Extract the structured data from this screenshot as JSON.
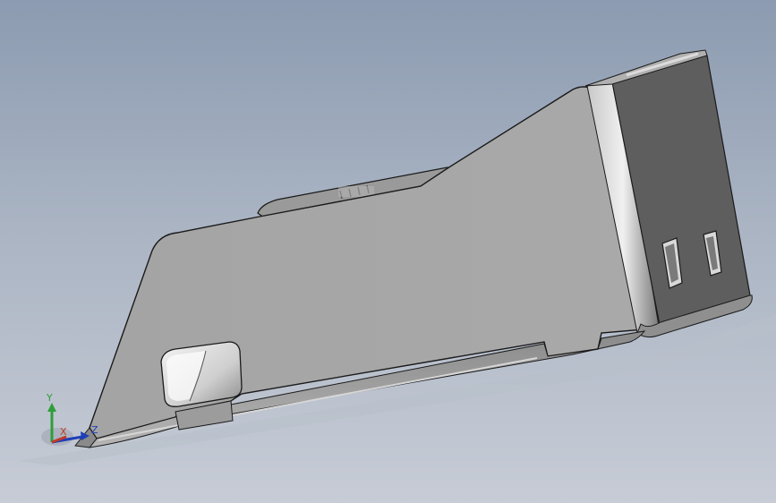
{
  "viewport": {
    "background_top": "#8c9bb1",
    "background_bottom": "#c7ccd6"
  },
  "model": {
    "face_color": "#a8a8a8",
    "dark_face_color": "#5e5e5e",
    "edge_color": "#1a1a1a"
  },
  "triad": {
    "x_label": "X",
    "y_label": "Y",
    "z_label": "Z",
    "x_color": "#c0392b",
    "y_color": "#2e9e3a",
    "z_color": "#1f3fb8"
  }
}
